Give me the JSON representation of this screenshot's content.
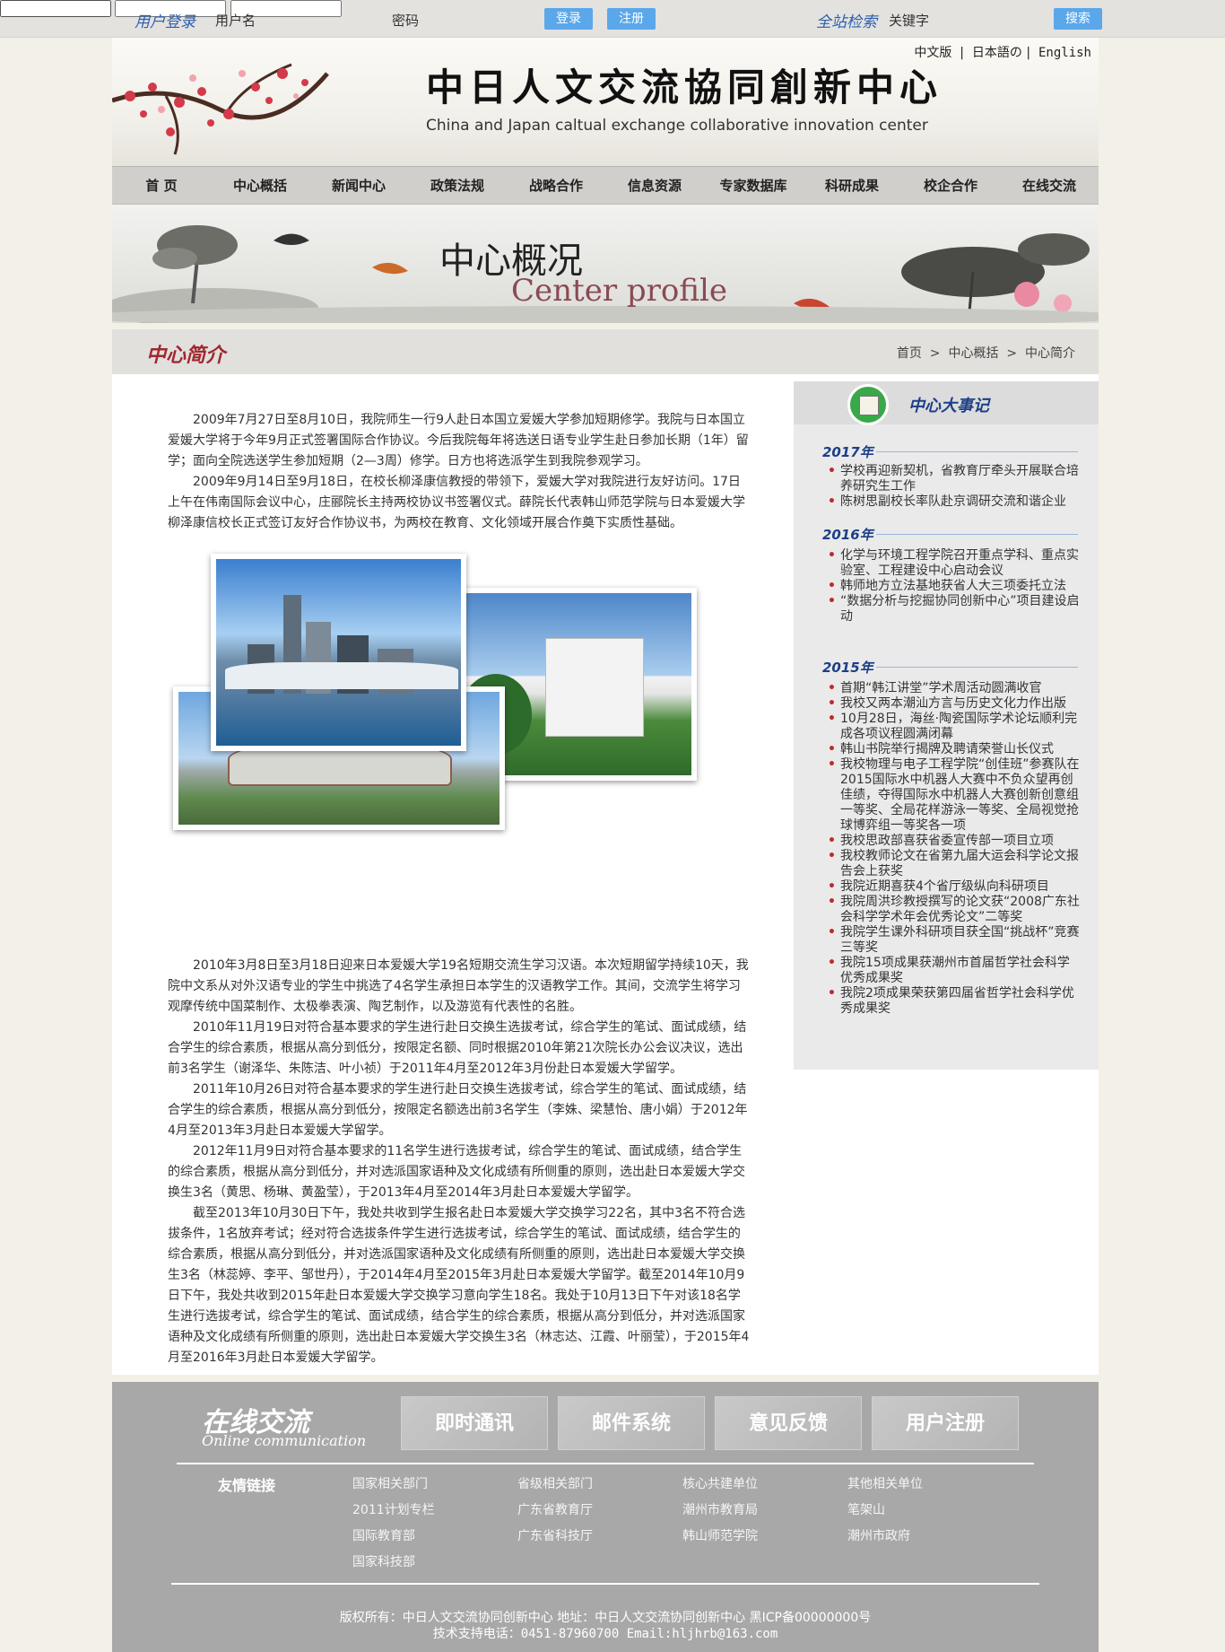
{
  "topbar": {
    "login_title": "用户登录",
    "username_label": "用户名",
    "password_label": "密码",
    "login_button": "登录",
    "register_button": "注册",
    "search_title": "全站检索",
    "keyword_label": "关键字",
    "search_button": "搜索"
  },
  "header": {
    "title_cn": "中日人文交流協同創新中心",
    "title_en": "China and Japan caltual exchange collaborative innovation center",
    "langs": [
      "中文版",
      "日本語の",
      "English"
    ]
  },
  "nav": [
    "首 页",
    "中心概括",
    "新闻中心",
    "政策法规",
    "战略合作",
    "信息资源",
    "专家数据库",
    "科研成果",
    "校企合作",
    "在线交流"
  ],
  "banner": {
    "title_cn": "中心概况",
    "title_en": "Center profile"
  },
  "page": {
    "title": "中心简介",
    "breadcrumb": [
      "首页",
      "中心概括",
      "中心简介"
    ]
  },
  "article": {
    "paras_top": [
      "2009年7月27日至8月10日，我院师生一行9人赴日本国立爱媛大学参加短期修学。我院与日本国立爱媛大学将于今年9月正式签署国际合作协议。今后我院每年将选送日语专业学生赴日参加长期（1年）留学；面向全院选送学生参加短期（2—3周）修学。日方也将选派学生到我院参观学习。",
      "2009年9月14日至9月18日，在校长柳泽康信教授的带领下，爱媛大学对我院进行友好访问。17日上午在伟南国际会议中心，庄郦院长主持两校协议书签署仪式。薛院长代表韩山师范学院与日本爱媛大学柳泽康信校长正式签订友好合作协议书，为两校在教育、文化领域开展合作奠下实质性基础。"
    ],
    "paras_bottom": [
      "2010年3月8日至3月18日迎来日本爱媛大学19名短期交流生学习汉语。本次短期留学持续10天，我院中文系从对外汉语专业的学生中挑选了4名学生承担日本学生的汉语教学工作。其间，交流学生将学习观摩传统中国菜制作、太极拳表演、陶艺制作，以及游览有代表性的名胜。",
      "2010年11月19日对符合基本要求的学生进行赴日交换生选拔考试，综合学生的笔试、面试成绩，结合学生的综合素质，根据从高分到低分，按限定名额、同时根据2010年第21次院长办公会议决议，选出前3名学生（谢泽华、朱陈洁、叶小祯）于2011年4月至2012年3月份赴日本爱媛大学留学。",
      "2011年10月26日对符合基本要求的学生进行赴日交换生选拔考试，综合学生的笔试、面试成绩，结合学生的综合素质，根据从高分到低分，按限定名额选出前3名学生（李姝、梁慧怡、唐小娟）于2012年4月至2013年3月赴日本爱媛大学留学。",
      "2012年11月9日对符合基本要求的11名学生进行选拔考试，综合学生的笔试、面试成绩，结合学生的综合素质，根据从高分到低分，并对选派国家语种及文化成绩有所侧重的原则，选出赴日本爱媛大学交换生3名（黄思、杨琳、黄盈莹），于2013年4月至2014年3月赴日本爱媛大学留学。",
      "截至2013年10月30日下午，我处共收到学生报名赴日本爱媛大学交换学习22名，其中3名不符合选拔条件，1名放弃考试；经对符合选拔条件学生进行选拔考试，综合学生的笔试、面试成绩，结合学生的综合素质，根据从高分到低分，并对选派国家语种及文化成绩有所侧重的原则，选出赴日本爱媛大学交换生3名（林蕊婷、李平、邹世丹），于2014年4月至2015年3月赴日本爱媛大学留学。截至2014年10月9日下午，我处共收到2015年赴日本爱媛大学交换学习意向学生18名。我处于10月13日下午对该18名学生进行选拔考试，综合学生的笔试、面试成绩，结合学生的综合素质，根据从高分到低分，并对选派国家语种及文化成绩有所侧重的原则，选出赴日本爱媛大学交换生3名（林志达、江霞、叶丽莹），于2015年4月至2016年3月赴日本爱媛大学留学。"
    ]
  },
  "sidebar": {
    "title": "中心大事记",
    "years": [
      {
        "year": "2017年",
        "items": [
          "学校再迎新契机，省教育厅牵头开展联合培养研究生工作",
          "陈树思副校长率队赴京调研交流和谐企业"
        ]
      },
      {
        "year": "2016年",
        "items": [
          "化学与环境工程学院召开重点学科、重点实验室、工程建设中心启动会议",
          "韩师地方立法基地获省人大三项委托立法",
          "“数据分析与挖掘协同创新中心”项目建设启动"
        ]
      },
      {
        "year": "2015年",
        "items": [
          "首期“韩江讲堂”学术周活动圆满收官",
          "我校又两本潮汕方言与历史文化力作出版",
          "10月28日，海丝·陶瓷国际学术论坛顺利完成各项议程圆满闭幕",
          "韩山书院举行揭牌及聘请荣誉山长仪式",
          "我校物理与电子工程学院“创佳班”参赛队在2015国际水中机器人大赛中不负众望再创佳绩，夺得国际水中机器人大赛创新创意组一等奖、全局花样游泳一等奖、全局视觉抢球博弈组一等奖各一项",
          "我校思政部喜获省委宣传部一项目立项",
          "我校教师论文在省第九届大运会科学论文报告会上获奖",
          "我院近期喜获4个省厅级纵向科研项目",
          "我院周洪珍教授撰写的论文获“2008广东社会科学学术年会优秀论文”二等奖",
          "我院学生课外科研项目获全国“挑战杯”竞赛三等奖",
          "我院15项成果获潮州市首届哲学社会科学优秀成果奖",
          "我院2项成果荣获第四届省哲学社会科学优秀成果奖"
        ]
      }
    ]
  },
  "footer": {
    "title_cn": "在线交流",
    "title_en": "Online communication",
    "buttons": [
      "即时通讯",
      "邮件系统",
      "意见反馈",
      "用户注册"
    ],
    "links_label": "友情链接",
    "links": [
      [
        "国家相关部门",
        "2011计划专栏",
        "国际教育部",
        "国家科技部"
      ],
      [
        "省级相关部门",
        "广东省教育厅",
        "广东省科技厅"
      ],
      [
        "核心共建单位",
        "潮州市教育局",
        "韩山师范学院"
      ],
      [
        "其他相关单位",
        "笔架山",
        "潮州市政府"
      ]
    ],
    "copyright_line1": "版权所有：中日人文交流协同创新中心  地址：中日人文交流协同创新中心  黑ICP备00000000号",
    "copyright_line2": "技术支持电话：0451-87960700 Email:hljhrb@163.com"
  }
}
